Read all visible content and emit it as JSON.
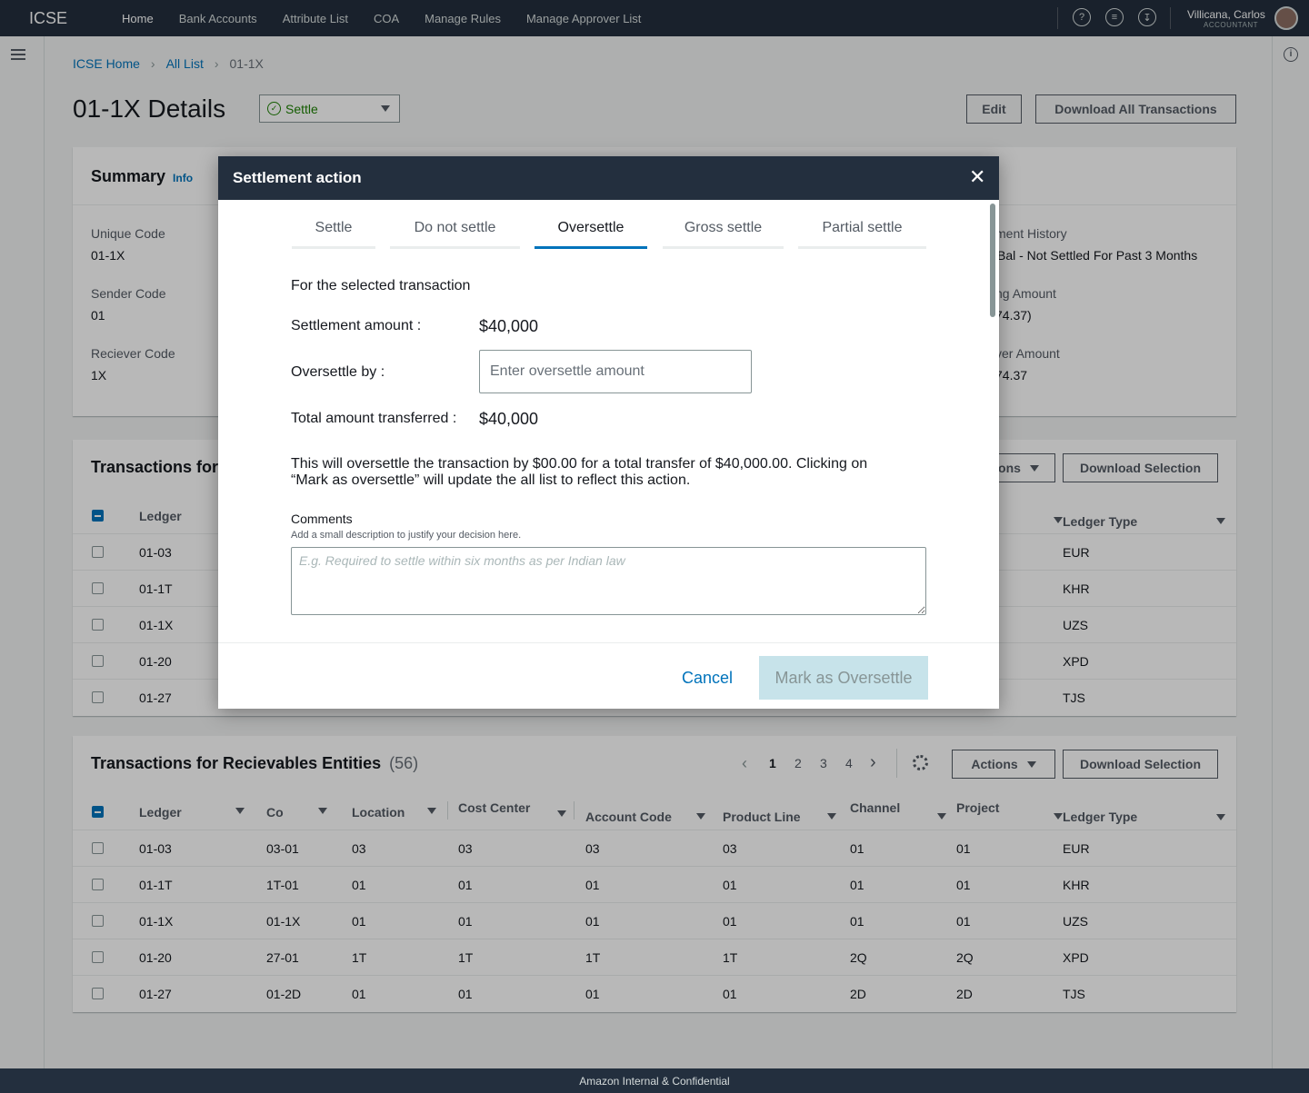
{
  "nav": {
    "brand": "ICSE",
    "links": [
      {
        "label": "Home",
        "active": true
      },
      {
        "label": "Bank Accounts",
        "active": false
      },
      {
        "label": "Attribute List",
        "active": false
      },
      {
        "label": "COA",
        "active": false
      },
      {
        "label": "Manage Rules",
        "active": false
      },
      {
        "label": "Manage Approver List",
        "active": false
      }
    ],
    "user_name": "Villicana, Carlos",
    "user_role": "ACCOUNTANT"
  },
  "breadcrumb": {
    "home": "ICSE Home",
    "list": "All List",
    "current": "01-1X"
  },
  "page": {
    "title": "01-1X Details",
    "status": "Settle",
    "edit_label": "Edit",
    "download_all_label": "Download All Transactions"
  },
  "summary": {
    "title": "Summary",
    "info": "Info",
    "unique_code_label": "Unique Code",
    "unique_code": "01-1X",
    "sender_code_label": "Sender Code",
    "sender_code": "01",
    "receiver_code_label": "Reciever Code",
    "receiver_code": "1X",
    "history_label": "ment History",
    "history_value": "Bal - Not Settled For Past 3 Months",
    "amount_label": "ng Amount",
    "amount_value": "74.37)",
    "receiver_amount_label": "ver Amount",
    "receiver_amount_value": "74.37"
  },
  "table1": {
    "title": "Transactions for",
    "actions_label": "ons",
    "download_label": "Download Selection",
    "ledger_header": "Ledger",
    "ledger_type_header": "Ledger Type",
    "rows": [
      {
        "ledger": "01-03",
        "type": "EUR"
      },
      {
        "ledger": "01-1T",
        "type": "KHR"
      },
      {
        "ledger": "01-1X",
        "type": "UZS"
      },
      {
        "ledger": "01-20",
        "type": "XPD"
      },
      {
        "ledger": "01-27",
        "type": "TJS"
      }
    ]
  },
  "table2": {
    "title": "Transactions for Recievables Entities",
    "count": "(56)",
    "pages": [
      "1",
      "2",
      "3",
      "4"
    ],
    "actions_label": "Actions",
    "download_label": "Download Selection",
    "headers": [
      "Ledger",
      "Co",
      "Location",
      "Cost Center",
      "Account Code",
      "Product Line",
      "Channel",
      "Project",
      "Ledger Type"
    ],
    "rows": [
      [
        "01-03",
        "03-01",
        "03",
        "03",
        "03",
        "03",
        "01",
        "01",
        "EUR"
      ],
      [
        "01-1T",
        "1T-01",
        "01",
        "01",
        "01",
        "01",
        "01",
        "01",
        "KHR"
      ],
      [
        "01-1X",
        "01-1X",
        "01",
        "01",
        "01",
        "01",
        "01",
        "01",
        "UZS"
      ],
      [
        "01-20",
        "27-01",
        "1T",
        "1T",
        "1T",
        "1T",
        "2Q",
        "2Q",
        "XPD"
      ],
      [
        "01-27",
        "01-2D",
        "01",
        "01",
        "01",
        "01",
        "2D",
        "2D",
        "TJS"
      ]
    ]
  },
  "modal": {
    "title": "Settlement action",
    "tabs": [
      {
        "label": "Settle",
        "active": false
      },
      {
        "label": "Do not settle",
        "active": false
      },
      {
        "label": "Oversettle",
        "active": true
      },
      {
        "label": "Gross settle",
        "active": false
      },
      {
        "label": "Partial settle",
        "active": false
      }
    ],
    "section_title": "For the selected transaction",
    "settlement_label": "Settlement amount :",
    "settlement_value": "$40,000",
    "oversettle_label": "Oversettle by :",
    "oversettle_placeholder": "Enter oversettle amount",
    "total_label": "Total amount transferred :",
    "total_value": "$40,000",
    "message_line1": "This will oversettle the transaction by $00.00 for a total transfer of $40,000.00. Clicking on",
    "message_line2": "“Mark as oversettle” will update the all list to reflect this action.",
    "comments_label": "Comments",
    "comments_hint": "Add a small description to justify your decision here.",
    "comments_placeholder": "E.g. Required to settle within six months as per Indian law",
    "cancel_label": "Cancel",
    "submit_label": "Mark as Oversettle"
  },
  "footer": {
    "text": "Amazon  Internal & Confidential"
  }
}
